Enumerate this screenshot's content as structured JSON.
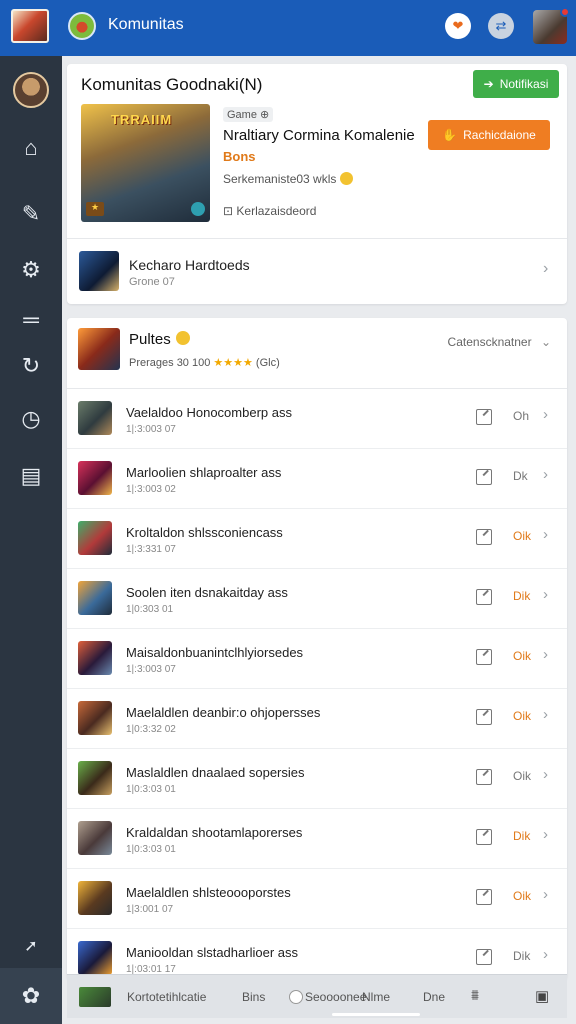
{
  "topbar": {
    "title": "Komunitas"
  },
  "card1": {
    "title": "Komunitas Goodnaki(N)",
    "follow_button": "Notifikasi",
    "thumb_title": "TRRAIIM",
    "genre_tag": "Game ⊕",
    "game_name": "Nraltiary Cormina Komalenie",
    "game_status": "Bons",
    "game_meta": "Serkemaniste03 wkls",
    "game_sub": "⊡ Kerlazaisdeord",
    "play_button": "Rachicdaione",
    "row_title": "Kecharo Hardtoeds",
    "row_sub": "Grone 07"
  },
  "card2": {
    "title": "Pultes",
    "meta_prefix": "Prerages 30 100",
    "meta_stars": "★★★★",
    "meta_suffix": "(Glc)",
    "sort_label": "Catenscknatner",
    "rows": [
      {
        "title": "Vaelaldoo Honocomberp ass",
        "sub": "1|:3:003 07",
        "status": "Oh",
        "status_color": "#777777",
        "thumb": "linear-gradient(135deg,#6b7d6a,#2f3b3f 55%,#b08a5a)"
      },
      {
        "title": "Marloolien shlaproalter ass",
        "sub": "1|:3:003 02",
        "status": "Dk",
        "status_color": "#777777",
        "thumb": "linear-gradient(135deg,#d8325a,#5b1032 55%,#f0b64a)"
      },
      {
        "title": "Kroltaldon shlssconiencass",
        "sub": "1|:3:331 07",
        "status": "Oik",
        "status_color": "#e07a1a",
        "thumb": "linear-gradient(135deg,#3fae6a,#b23a3a 55%,#1f2c3a)"
      },
      {
        "title": "Soolen iten dsnakaitday ass",
        "sub": "1|0:303 01",
        "status": "Dik",
        "status_color": "#e07a1a",
        "thumb": "linear-gradient(135deg,#f0a43a,#3a6a9a 55%,#1f2c3a)"
      },
      {
        "title": "Maisaldonbuanintclhlyiorsedes",
        "sub": "1|:3:003 07",
        "status": "Oik",
        "status_color": "#e07a1a",
        "thumb": "linear-gradient(135deg,#e0603a,#2a1a3a 55%,#6a8ab0)"
      },
      {
        "title": "Maelaldlen deanbir:o ohjopersses",
        "sub": "1|0:3:32 02",
        "status": "Oik",
        "status_color": "#e07a1a",
        "thumb": "linear-gradient(135deg,#c86a3a,#4a2a20 55%,#e8c070)"
      },
      {
        "title": "Maslaldlen dnaalaed sopersies",
        "sub": "1|0:3:03 01",
        "status": "Oik",
        "status_color": "#777777",
        "thumb": "linear-gradient(135deg,#6ab04a,#3a2a1a 55%,#c8a060)"
      },
      {
        "title": "Kraldaldan shootamlaporerses",
        "sub": "1|0:3:03 01",
        "status": "Dik",
        "status_color": "#e07a1a",
        "thumb": "linear-gradient(135deg,#b0a090,#4a3a3a 55%,#7a8a9a)"
      },
      {
        "title": "Maelaldlen shlsteoooporstes",
        "sub": "1|3:001 07",
        "status": "Oik",
        "status_color": "#e07a1a",
        "thumb": "linear-gradient(135deg,#f0b43a,#5a3a20 55%,#2a2a2a)"
      },
      {
        "title": "Maniooldan slstadharlioer ass",
        "sub": "1|:03:01 17",
        "status": "Dik",
        "status_color": "#777777",
        "thumb": "linear-gradient(135deg,#3a6ad0,#1a1a3a 55%,#f0a030)"
      }
    ]
  },
  "bottombar": {
    "item1": "Kortotetihlcatie",
    "item2": "Bins",
    "item3": "Seoooonee",
    "item4": "Nlme",
    "item5": "Dne"
  }
}
